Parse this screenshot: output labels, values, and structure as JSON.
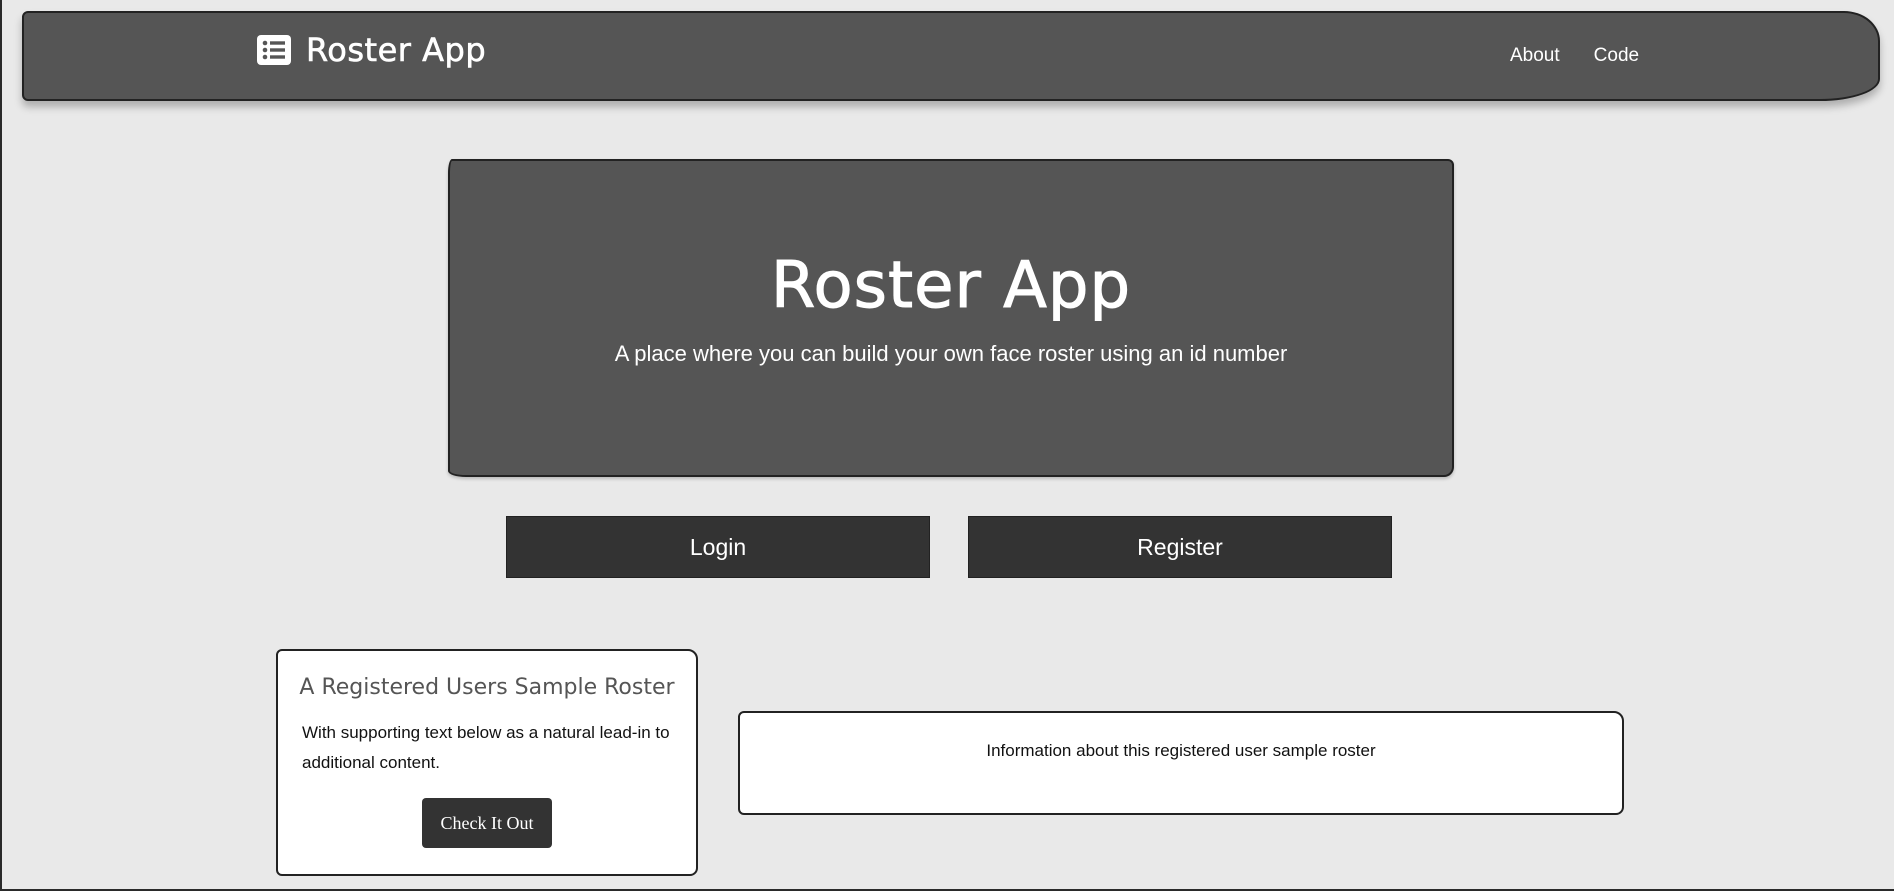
{
  "navbar": {
    "brand_icon": "list-alt-icon",
    "brand_title": "Roster App",
    "links": [
      "About",
      "Code"
    ]
  },
  "hero": {
    "title": "Roster App",
    "subtitle": "A place where you can build your own face roster using an id number"
  },
  "actions": {
    "login_label": "Login",
    "register_label": "Register"
  },
  "sample_card": {
    "title": "A Registered Users Sample Roster",
    "text": "With supporting text below as a natural lead-in to additional content.",
    "button_label": "Check It Out"
  },
  "info_box": {
    "text": "Information about this registered user sample roster"
  },
  "colors": {
    "background": "#e9e9e9",
    "panel": "#555555",
    "button": "#333333"
  }
}
